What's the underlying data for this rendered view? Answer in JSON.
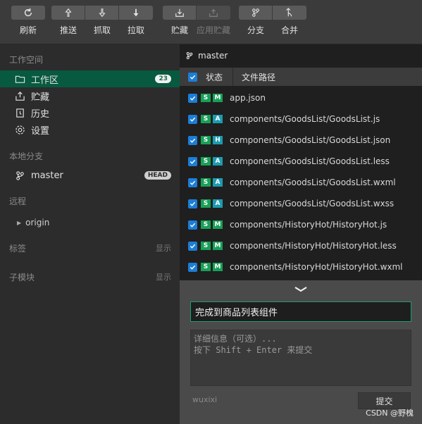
{
  "toolbar": {
    "refresh": "刷新",
    "push": "推送",
    "fetch": "抓取",
    "pull": "拉取",
    "stash": "贮藏",
    "apply_stash": "应用贮藏",
    "branch": "分支",
    "merge": "合并"
  },
  "sidebar": {
    "workspace_title": "工作空间",
    "items": [
      {
        "label": "工作区",
        "badge": "23"
      },
      {
        "label": "贮藏"
      },
      {
        "label": "历史"
      },
      {
        "label": "设置"
      }
    ],
    "local_branch_title": "本地分支",
    "branch_name": "master",
    "head_badge": "HEAD",
    "remote_title": "远程",
    "remote_name": "origin",
    "tags_title": "标签",
    "tags_show": "显示",
    "submodule_title": "子模块",
    "submodule_show": "显示"
  },
  "changes": {
    "branch": "master",
    "col_status": "状态",
    "col_path": "文件路径",
    "files": [
      {
        "status": [
          "S",
          "M"
        ],
        "path": "app.json"
      },
      {
        "status": [
          "S",
          "A"
        ],
        "path": "components/GoodsList/GoodsList.js"
      },
      {
        "status": [
          "S",
          "H"
        ],
        "path": "components/GoodsList/GoodsList.json"
      },
      {
        "status": [
          "S",
          "A"
        ],
        "path": "components/GoodsList/GoodsList.less"
      },
      {
        "status": [
          "S",
          "A"
        ],
        "path": "components/GoodsList/GoodsList.wxml"
      },
      {
        "status": [
          "S",
          "A"
        ],
        "path": "components/GoodsList/GoodsList.wxss"
      },
      {
        "status": [
          "S",
          "M"
        ],
        "path": "components/HistoryHot/HistoryHot.js"
      },
      {
        "status": [
          "S",
          "M"
        ],
        "path": "components/HistoryHot/HistoryHot.less"
      },
      {
        "status": [
          "S",
          "M"
        ],
        "path": "components/HistoryHot/HistoryHot.wxml"
      }
    ]
  },
  "commit": {
    "message": "完成到商品列表组件",
    "detail_placeholder_line1": "详细信息（可选）...",
    "detail_placeholder_line2": "按下 Shift + Enter 来提交",
    "author": "wuxixi",
    "submit_label": "提交",
    "watermark": "CSDN @野槐"
  },
  "colors": {
    "accent": "#075a3f",
    "checkbox": "#1c7ed6",
    "tag_modified": "#18a058",
    "tag_added": "#1c9bb0"
  }
}
